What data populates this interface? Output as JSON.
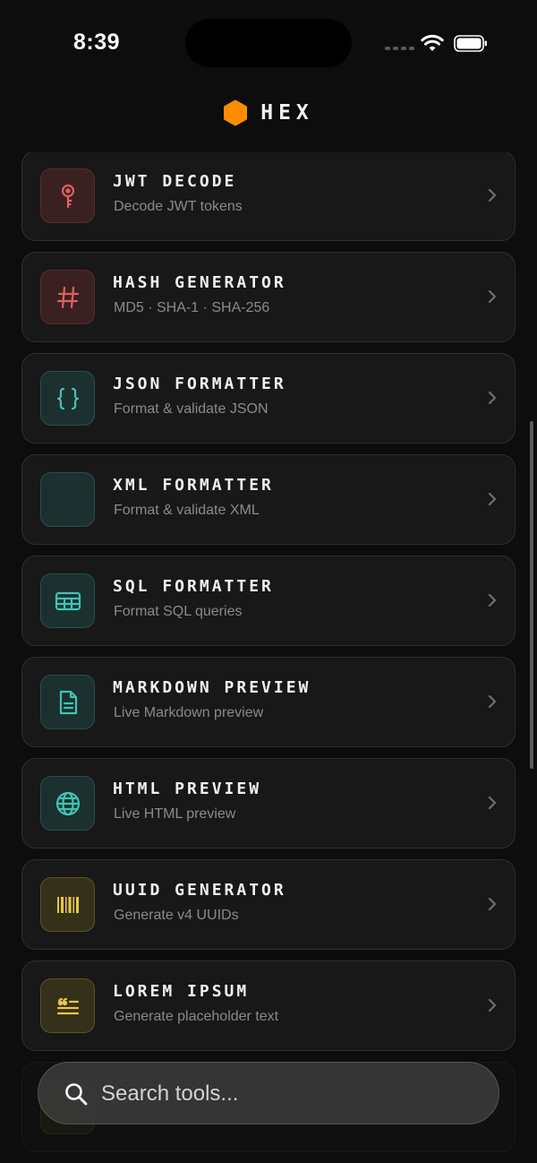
{
  "status_bar": {
    "time": "8:39"
  },
  "header": {
    "logo_icon": "hexagon-icon",
    "brand_color": "#FF8C00",
    "title": "HEX"
  },
  "tools": [
    {
      "title": "JWT DECODE",
      "subtitle": "Decode JWT tokens",
      "icon": "key-icon",
      "accent": "#E0605C"
    },
    {
      "title": "HASH GENERATOR",
      "subtitle": "MD5 · SHA-1 · SHA-256",
      "icon": "hash-icon",
      "accent": "#E0605C"
    },
    {
      "title": "JSON FORMATTER",
      "subtitle": "Format & validate JSON",
      "icon": "braces-icon",
      "accent": "#3FC4B4"
    },
    {
      "title": "XML FORMATTER",
      "subtitle": "Format & validate XML",
      "icon": "code-icon",
      "accent": "#3FC4B4"
    },
    {
      "title": "SQL FORMATTER",
      "subtitle": "Format SQL queries",
      "icon": "table-icon",
      "accent": "#3FC4B4"
    },
    {
      "title": "MARKDOWN PREVIEW",
      "subtitle": "Live Markdown preview",
      "icon": "document-icon",
      "accent": "#3FC4B4"
    },
    {
      "title": "HTML PREVIEW",
      "subtitle": "Live HTML preview",
      "icon": "globe-icon",
      "accent": "#3FC4B4"
    },
    {
      "title": "UUID GENERATOR",
      "subtitle": "Generate v4 UUIDs",
      "icon": "barcode-icon",
      "accent": "#E8C547"
    },
    {
      "title": "LOREM IPSUM",
      "subtitle": "Generate placeholder text",
      "icon": "quote-text-icon",
      "accent": "#E8C547"
    }
  ],
  "search": {
    "placeholder": "Search tools..."
  }
}
